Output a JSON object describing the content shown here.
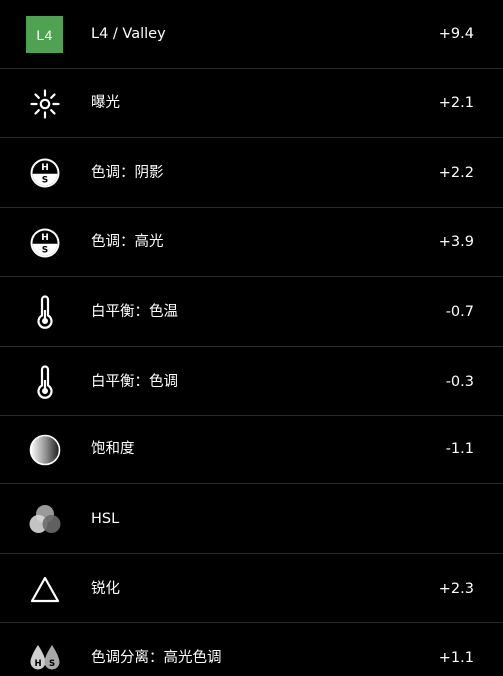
{
  "rows": [
    {
      "badge": "L4",
      "label": "L4 / Valley",
      "value": "+9.4",
      "icon": "preset-badge-icon",
      "badge_color": "#4fa252"
    },
    {
      "label": "曝光",
      "value": "+2.1",
      "icon": "sun-icon"
    },
    {
      "label": "色调：阴影",
      "value": "+2.2",
      "icon": "hs-tone-icon"
    },
    {
      "label": "色调：高光",
      "value": "+3.9",
      "icon": "hs-tone-icon"
    },
    {
      "label": "白平衡：色温",
      "value": "-0.7",
      "icon": "thermometer-icon"
    },
    {
      "label": "白平衡：色调",
      "value": "-0.3",
      "icon": "thermometer-icon"
    },
    {
      "label": "饱和度",
      "value": "-1.1",
      "icon": "saturation-gradient-icon"
    },
    {
      "label": "HSL",
      "value": "",
      "icon": "hsl-circles-icon"
    },
    {
      "label": "锐化",
      "value": "+2.3",
      "icon": "triangle-icon"
    },
    {
      "label": "色调分离：高光色调",
      "value": "+1.1",
      "icon": "split-tone-drops-icon"
    }
  ]
}
